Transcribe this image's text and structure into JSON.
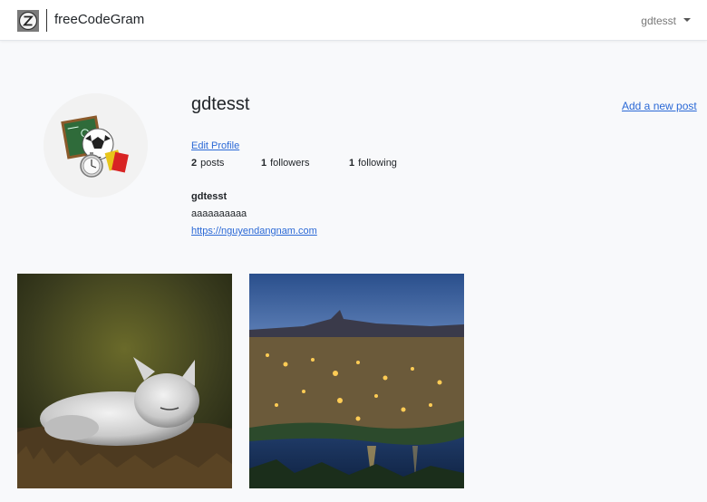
{
  "app": {
    "brand_name": "freeCodeGram",
    "brand_logo_icon": "z-logo-icon"
  },
  "nav": {
    "user_label": "gdtesst",
    "dropdown_icon": "caret-down-icon"
  },
  "profile": {
    "username": "gdtesst",
    "add_post_label": "Add a new post",
    "edit_profile_label": "Edit Profile",
    "stats": {
      "posts_count": "2",
      "posts_label": "posts",
      "followers_count": "1",
      "followers_label": "followers",
      "following_count": "1",
      "following_label": "following"
    },
    "title": "gdtesst",
    "description": "aaaaaaaaaa",
    "url": "https://nguyendangnam.com",
    "avatar_icon": "soccer-referee-icon"
  },
  "posts": [
    {
      "image": "arctic-fox-photo"
    },
    {
      "image": "night-city-photo"
    }
  ],
  "colors": {
    "link": "#2b69d6",
    "background": "#f8f9fb",
    "navbar": "#ffffff"
  }
}
